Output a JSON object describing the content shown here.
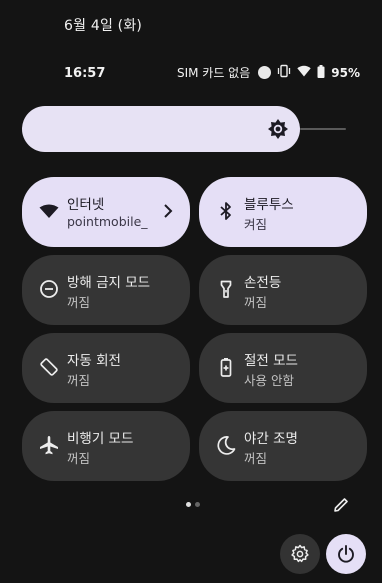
{
  "status": {
    "date": "6월 4일 (화)",
    "time": "16:57",
    "sim_text": "SIM 카드 없음",
    "battery_percent": "95%"
  },
  "brightness": {
    "level": 0.85
  },
  "tiles": [
    {
      "label": "인터넷",
      "sub": "pointmobile_",
      "state": "on",
      "icon": "wifi-icon",
      "has_chevron": true
    },
    {
      "label": "블루투스",
      "sub": "켜짐",
      "state": "on",
      "icon": "bluetooth-icon"
    },
    {
      "label": "방해 금지 모드",
      "sub": "꺼짐",
      "state": "off",
      "icon": "do-not-disturb-icon"
    },
    {
      "label": "손전등",
      "sub": "꺼짐",
      "state": "off",
      "icon": "flashlight-icon"
    },
    {
      "label": "자동 회전",
      "sub": "꺼짐",
      "state": "off",
      "icon": "auto-rotate-icon"
    },
    {
      "label": "절전 모드",
      "sub": "사용 안함",
      "state": "off",
      "icon": "battery-saver-icon"
    },
    {
      "label": "비행기 모드",
      "sub": "꺼짐",
      "state": "off",
      "icon": "airplane-icon"
    },
    {
      "label": "야간 조명",
      "sub": "꺼짐",
      "state": "off",
      "icon": "night-light-icon"
    }
  ],
  "pager": {
    "current": 1,
    "total": 2
  },
  "colors": {
    "tile_on": "#e5dff6",
    "tile_off": "#353535",
    "background": "#141414"
  }
}
